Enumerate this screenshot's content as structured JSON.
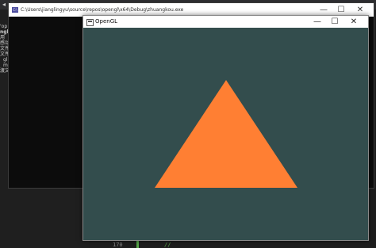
{
  "ide": {
    "solution_lines": [
      "'op",
      "ngk",
      "用",
      "感动",
      "文件",
      "文件",
      "gl",
      "ma",
      "渡文"
    ],
    "line_numbers": [
      "",
      "170"
    ],
    "comment_text": "//"
  },
  "console_window": {
    "title": "C:\\Users\\jianglingyu\\source\\repos\\opengl\\x64\\Debug\\zhuangkou.exe",
    "icon_label": "C:\\",
    "minimize": "—",
    "maximize": "☐",
    "close": "✕"
  },
  "opengl_window": {
    "title": "OpenGL",
    "minimize": "—",
    "maximize": "☐",
    "close": "✕",
    "background_color": "#334d4d",
    "triangle_color": "#ff7f33"
  }
}
